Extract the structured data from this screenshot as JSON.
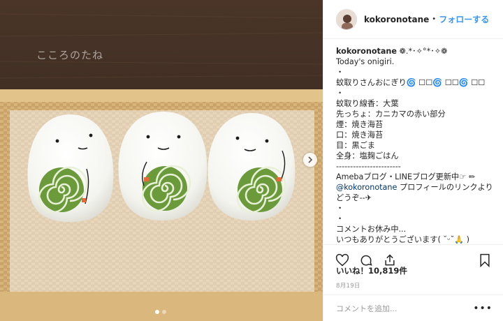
{
  "post": {
    "username": "kokoronotane",
    "follow_label": "フォローする",
    "separator": "•",
    "caption": {
      "username": "kokoronotane",
      "header_suffix": "❁.*･✧°*･✧❁",
      "lines": [
        "Today's onigiri.",
        "・",
        "蚊取りさんおにぎり🌀 ☐☐🌀 ☐☐🌀 ☐☐",
        "・",
        "蚊取り線香：大葉",
        "先っちょ：カニカマの赤い部分",
        "煙：焼き海苔",
        "口：焼き海苔",
        "目：黒ごま",
        "全身：塩麹ごはん",
        "-----------------------",
        "Amebaブログ・LINEブログ更新中☞ ✏"
      ],
      "mention": "@kokoronotane",
      "mention_tail": " プロフィールのリンクよりどうぞ--✈",
      "lines_after": [
        "・",
        "・",
        "コメントお休み中...",
        "いつもありがとうございます( ˘ᵕ˘🙏 )",
        "・",
        "・"
      ]
    },
    "likes_label": "いいね！10,819件",
    "date": "8月19日",
    "comment_placeholder": "コメントを追加...",
    "more_label": "•••"
  },
  "photo": {
    "watermark": "こころのたね",
    "carousel_dots": 2,
    "active_dot": 0
  },
  "icons": {
    "like": "heart-icon",
    "comment": "comment-icon",
    "share": "share-icon",
    "save": "bookmark-icon",
    "next": "chevron-right-icon"
  },
  "colors": {
    "link": "#3897f0",
    "text": "#262626",
    "muted": "#999999"
  }
}
